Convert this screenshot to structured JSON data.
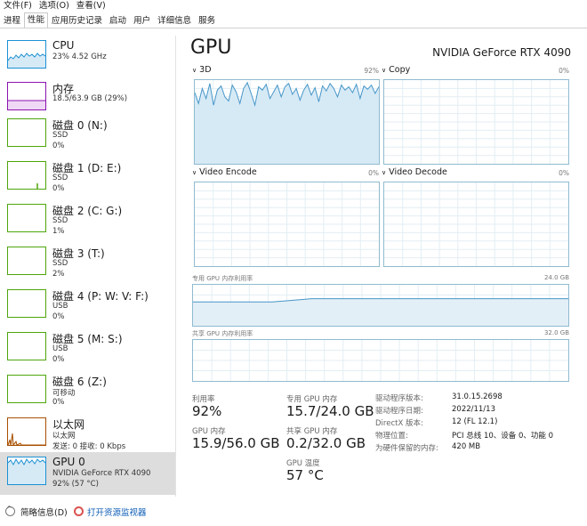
{
  "menu": [
    "文件(F)",
    "选项(O)",
    "查看(V)"
  ],
  "tabs": [
    "进程",
    "性能",
    "应用历史记录",
    "启动",
    "用户",
    "详细信息",
    "服务"
  ],
  "active_tab": "性能",
  "sidebar": [
    {
      "title": "CPU",
      "lines": [
        "23%  4.52 GHz"
      ]
    },
    {
      "title": "内存",
      "lines": [
        "18.5/63.9 GB (29%)"
      ]
    },
    {
      "title": "磁盘 0 (N:)",
      "lines": [
        "SSD",
        "0%"
      ]
    },
    {
      "title": "磁盘 1 (D: E:)",
      "lines": [
        "SSD",
        "0%"
      ]
    },
    {
      "title": "磁盘 2 (C: G:)",
      "lines": [
        "SSD",
        "1%"
      ]
    },
    {
      "title": "磁盘 3 (T:)",
      "lines": [
        "SSD",
        "2%"
      ]
    },
    {
      "title": "磁盘 4 (P: W: V: F:)",
      "lines": [
        "USB",
        "0%"
      ]
    },
    {
      "title": "磁盘 5 (M: S:)",
      "lines": [
        "USB",
        "0%"
      ]
    },
    {
      "title": "磁盘 6 (Z:)",
      "lines": [
        "可移动",
        "0%"
      ]
    },
    {
      "title": "以太网",
      "lines": [
        "以太网",
        "发送: 0  接收: 0 Kbps"
      ]
    },
    {
      "title": "GPU 0",
      "lines": [
        "NVIDIA GeForce RTX 4090",
        "92% (57 °C)"
      ]
    }
  ],
  "main": {
    "title": "GPU",
    "model": "NVIDIA GeForce RTX 4090",
    "engines": [
      {
        "name": "3D",
        "percent": "92%",
        "usage": [
          0.85,
          0.72,
          0.9,
          0.78,
          0.96,
          0.7,
          0.88,
          0.93,
          0.8,
          0.75,
          0.94,
          0.86,
          0.72,
          0.9,
          0.97,
          0.84,
          0.7,
          0.92,
          0.88,
          0.95,
          0.78,
          0.86,
          0.94,
          0.8,
          0.92,
          0.96,
          0.83,
          0.9,
          0.76,
          0.88,
          0.95,
          0.82,
          0.91,
          0.74,
          0.93,
          0.87,
          0.96,
          0.9,
          0.8,
          0.94,
          0.88,
          0.92,
          0.85,
          0.95,
          0.78,
          0.93,
          0.89,
          0.94,
          0.84,
          0.92
        ]
      },
      {
        "name": "Copy",
        "percent": "0%"
      },
      {
        "name": "Video Encode",
        "percent": "0%"
      },
      {
        "name": "Video Decode",
        "percent": "0%"
      }
    ],
    "dedicated_memory": {
      "label": "专用 GPU 内存利用率",
      "max": "24.0 GB",
      "usage": [
        0.58,
        0.58,
        0.58,
        0.58,
        0.58,
        0.62,
        0.66,
        0.66,
        0.66,
        0.66,
        0.66,
        0.66,
        0.66,
        0.66,
        0.66,
        0.66,
        0.66,
        0.66,
        0.66,
        0.66
      ]
    },
    "shared_memory": {
      "label": "共享 GPU 内存利用率",
      "max": "32.0 GB"
    },
    "stats": {
      "utilization_label": "利用率",
      "utilization": "92%",
      "dedicated_label": "专用 GPU 内存",
      "dedicated": "15.7/24.0 GB",
      "gpu_mem_label": "GPU 内存",
      "gpu_mem": "15.9/56.0 GB",
      "shared_label": "共享 GPU 内存",
      "shared": "0.2/32.0 GB",
      "temp_label": "GPU 温度",
      "temp": "57 °C"
    },
    "info": [
      {
        "key": "驱动程序版本:",
        "value": "31.0.15.2698"
      },
      {
        "key": "驱动程序日期:",
        "value": "2022/11/13"
      },
      {
        "key": "DirectX 版本:",
        "value": "12 (FL 12.1)"
      },
      {
        "key": "物理位置:",
        "value": "PCI 总线 10、设备 0、功能 0"
      },
      {
        "key": "为硬件保留的内存:",
        "value": "420 MB"
      }
    ]
  },
  "footer": {
    "summary": "简略信息(D)",
    "resmon": "打开资源监视器"
  },
  "colors": {
    "cpu": "#1c90d4",
    "memory": "#8b12ae",
    "disk": "#4da60c",
    "ethernet": "#a74f01",
    "gpu_border": "#76b900",
    "graph_line": "#4796c8"
  }
}
